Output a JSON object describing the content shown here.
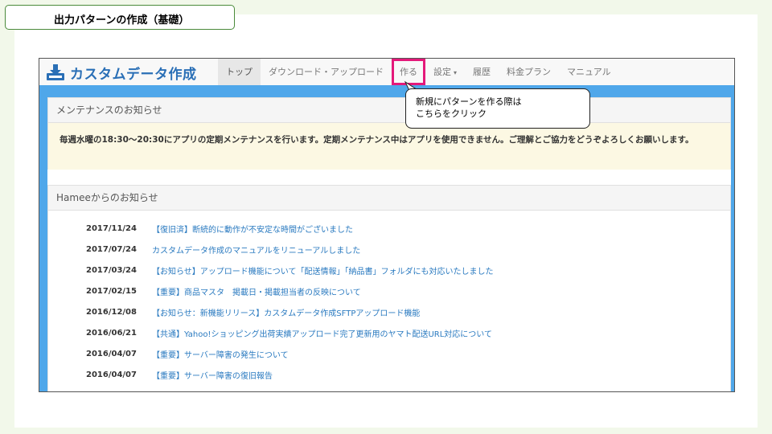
{
  "slide": {
    "title": "出力パターンの作成（基礎）"
  },
  "app": {
    "brand": "カスタムデータ作成",
    "nav": [
      {
        "label": "トップ"
      },
      {
        "label": "ダウンロード・アップロード"
      },
      {
        "label": "作る"
      },
      {
        "label": "設定",
        "caret": "▾"
      },
      {
        "label": "履歴"
      },
      {
        "label": "料金プラン"
      },
      {
        "label": "マニュアル"
      }
    ]
  },
  "callout": {
    "line1": "新規にパターンを作る際は",
    "line2": "こちらをクリック"
  },
  "maintenance": {
    "heading": "メンテナンスのお知らせ",
    "body": "毎週水曜の18:30〜20:30にアプリの定期メンテナンスを行います。定期メンテナンス中はアプリを使用できません。ご理解とご協力をどうぞよろしくお願いします。"
  },
  "news": {
    "heading": "Hameeからのお知らせ",
    "items": [
      {
        "date": "2017/11/24",
        "title": "【復旧済】断続的に動作が不安定な時間がございました"
      },
      {
        "date": "2017/07/24",
        "title": "カスタムデータ作成のマニュアルをリニューアルしました"
      },
      {
        "date": "2017/03/24",
        "title": "【お知らせ】アップロード機能について「配送情報」「納品書」フォルダにも対応いたしました"
      },
      {
        "date": "2017/02/15",
        "title": "【重要】商品マスタ　掲載日・掲載担当者の反映について"
      },
      {
        "date": "2016/12/08",
        "title": "【お知らせ：新機能リリース】カスタムデータ作成SFTPアップロード機能"
      },
      {
        "date": "2016/06/21",
        "title": "【共通】Yahoo!ショッピング出荷実績アップロード完了更新用のヤマト配送URL対応について"
      },
      {
        "date": "2016/04/07",
        "title": "【重要】サーバー障害の発生について"
      },
      {
        "date": "2016/04/07",
        "title": "【重要】サーバー障害の復旧報告"
      }
    ]
  }
}
